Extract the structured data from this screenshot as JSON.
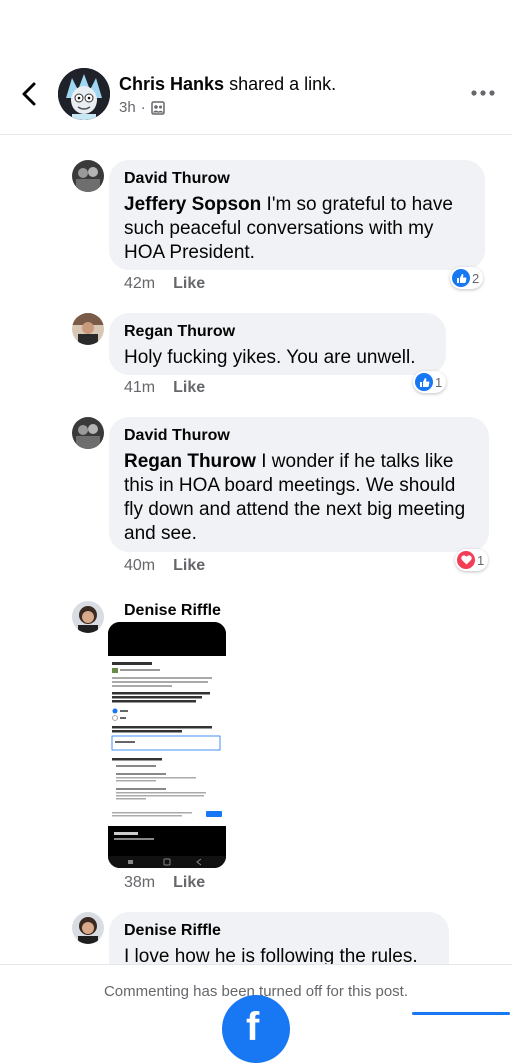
{
  "header": {
    "author": "Chris Hanks",
    "action": "shared a link.",
    "time": "3h",
    "dot": "·",
    "privacy_icon": "group-icon"
  },
  "cut_meta": "42m   Like",
  "comments": [
    {
      "name": "David Thurow",
      "mention": "Jeffery Sopson",
      "text": " I'm so grateful to have such peaceful conversations with my HOA President.",
      "time": "42m",
      "like": "Like",
      "reaction": {
        "type": "like",
        "count": "2"
      }
    },
    {
      "name": "Regan Thurow",
      "mention": "",
      "text": "Holy fucking yikes. You are unwell.",
      "time": "41m",
      "like": "Like",
      "reaction": {
        "type": "like",
        "count": "1"
      }
    },
    {
      "name": "David Thurow",
      "mention": "Regan Thurow",
      "text": " I wonder if he talks like this in HOA board meetings. We should fly down and attend the next big meeting and see.",
      "time": "40m",
      "like": "Like",
      "reaction": {
        "type": "love",
        "count": "1"
      }
    },
    {
      "name": "Denise Riffle",
      "attachment": "screenshot-image",
      "time": "38m",
      "like": "Like"
    },
    {
      "name": "Denise Riffle",
      "mention": "",
      "text": "I love how he is following the rules."
    }
  ],
  "footer": {
    "notice": "Commenting has been turned off for this post."
  },
  "colors": {
    "brand_blue": "#1877f2",
    "bubble": "#f0f2f5",
    "secondary_text": "#65676b",
    "love_red": "#f33e58"
  }
}
